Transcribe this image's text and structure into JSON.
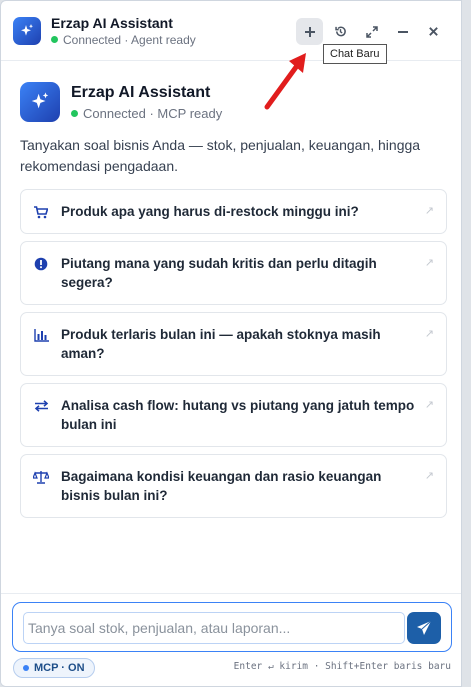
{
  "titlebar": {
    "title": "Erzap AI Assistant",
    "status": "Connected · Agent ready"
  },
  "tooltip": "Chat Baru",
  "hero": {
    "title": "Erzap AI Assistant",
    "status": "Connected · MCP ready"
  },
  "intro": "Tanyakan soal bisnis Anda — stok, penjualan, keuangan, hingga rekomendasi pengadaan.",
  "suggestions": [
    {
      "icon": "cart-icon",
      "text": "Produk apa yang harus di-restock minggu ini?"
    },
    {
      "icon": "alert-icon",
      "text": "Piutang mana yang sudah kritis dan perlu ditagih segera?"
    },
    {
      "icon": "bar-chart-icon",
      "text": "Produk terlaris bulan ini — apakah stoknya masih aman?"
    },
    {
      "icon": "swap-icon",
      "text": "Analisa cash flow: hutang vs piutang yang jatuh tempo bulan ini"
    },
    {
      "icon": "scale-icon",
      "text": "Bagaimana kondisi keuangan dan rasio keuangan bisnis bulan ini?"
    }
  ],
  "composer": {
    "placeholder": "Tanya soal stok, penjualan, atau laporan...",
    "mcp_badge": "MCP · ON",
    "hint": "Enter ↵ kirim  ·  Shift+Enter baris baru"
  },
  "colors": {
    "accent": "#1d5fa8",
    "status_green": "#22c55e",
    "arrow_red": "#e11d1d"
  }
}
